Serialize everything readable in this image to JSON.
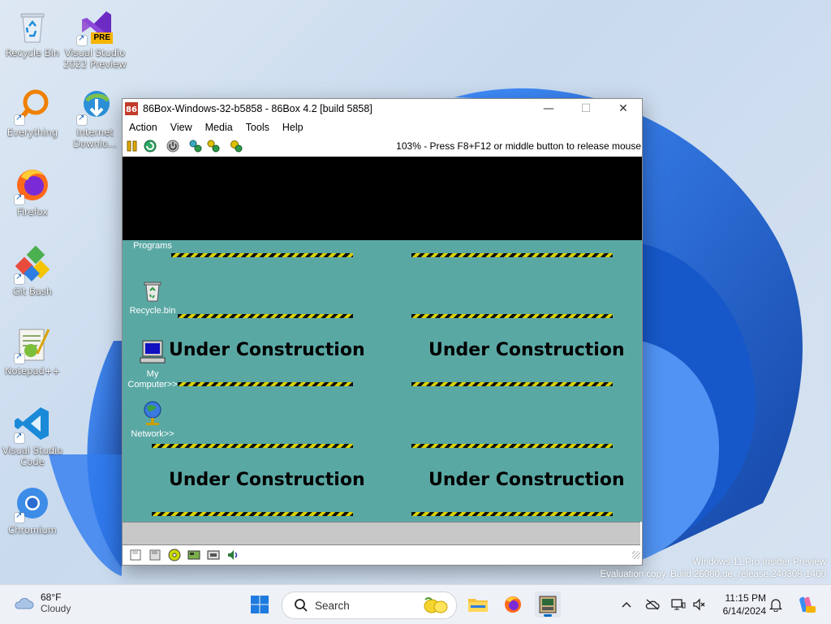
{
  "desktop": {
    "icons": [
      {
        "label": "Recycle Bin"
      },
      {
        "label": "Visual Studio 2022 Preview",
        "badge": "PRE"
      },
      {
        "label": "Everything"
      },
      {
        "label": "Internet Downlo..."
      },
      {
        "label": "Firefox"
      },
      {
        "label": "Git Bash"
      },
      {
        "label": "Notepad++"
      },
      {
        "label": "Visual Studio Code"
      },
      {
        "label": "Chromium"
      }
    ]
  },
  "window": {
    "title": "86Box-Windows-32-b5858 - 86Box 4.2 [build 5858]",
    "controls": {
      "minimize": "—",
      "maximize": "☐",
      "close": "✕"
    },
    "menu": [
      "Action",
      "View",
      "Media",
      "Tools",
      "Help"
    ],
    "toolbar_status": "103% - Press F8+F12 or middle button to release mouse",
    "vm_screen": {
      "background": "#5aa8a4",
      "banners": [
        "Under Construction",
        "Under Construction",
        "Under Construction",
        "Under Construction"
      ],
      "icons": [
        {
          "label": "Programs"
        },
        {
          "label": "Recycle.bin"
        },
        {
          "label": "My Computer>>"
        },
        {
          "label": "Network>>"
        }
      ]
    }
  },
  "watermark": {
    "line1": "Windows 11 Pro Insider Preview",
    "line2": "Evaluation copy. Build 26080.ge_release.240308-1400"
  },
  "taskbar": {
    "weather": {
      "temp": "68°F",
      "condition": "Cloudy"
    },
    "search_label": "Search",
    "clock": {
      "time": "11:15 PM",
      "date": "6/14/2024"
    }
  },
  "colors": {
    "accent": "#0067c0",
    "vm_teal": "#5aa8a4",
    "hazard_yellow": "#d8d000"
  }
}
